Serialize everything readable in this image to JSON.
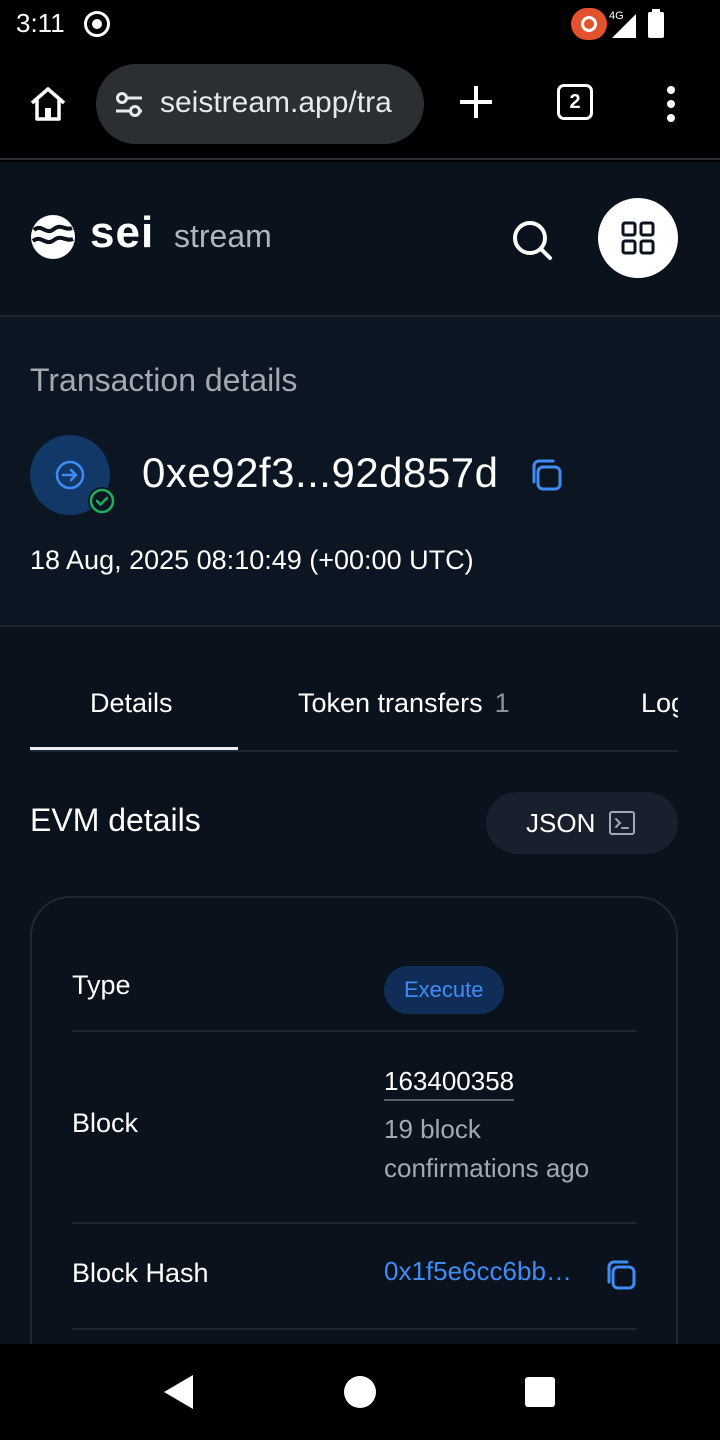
{
  "status_bar": {
    "time": "3:11",
    "network": "4G"
  },
  "browser": {
    "url": "seistream.app/tra",
    "tab_count": "2"
  },
  "header": {
    "logo_primary": "sei",
    "logo_secondary": "stream"
  },
  "transaction": {
    "heading": "Transaction details",
    "hash": "0xe92f3...92d857d",
    "timestamp": "18 Aug, 2025 08:10:49 (+00:00 UTC)"
  },
  "tabs": {
    "details": "Details",
    "token_transfers": "Token transfers",
    "token_transfers_count": "1",
    "logs": "Logs"
  },
  "evm": {
    "title": "EVM details",
    "json_label": "JSON"
  },
  "details": {
    "type_label": "Type",
    "type_value": "Execute",
    "block_label": "Block",
    "block_number": "163400358",
    "block_confirmations": "19 block confirmations ago",
    "block_hash_label": "Block Hash",
    "block_hash_value": "0x1f5e6cc6bb…"
  },
  "colors": {
    "page_bg": "#0a121d",
    "accent_blue": "#3f8cf5",
    "success_green": "#1fb05c"
  }
}
